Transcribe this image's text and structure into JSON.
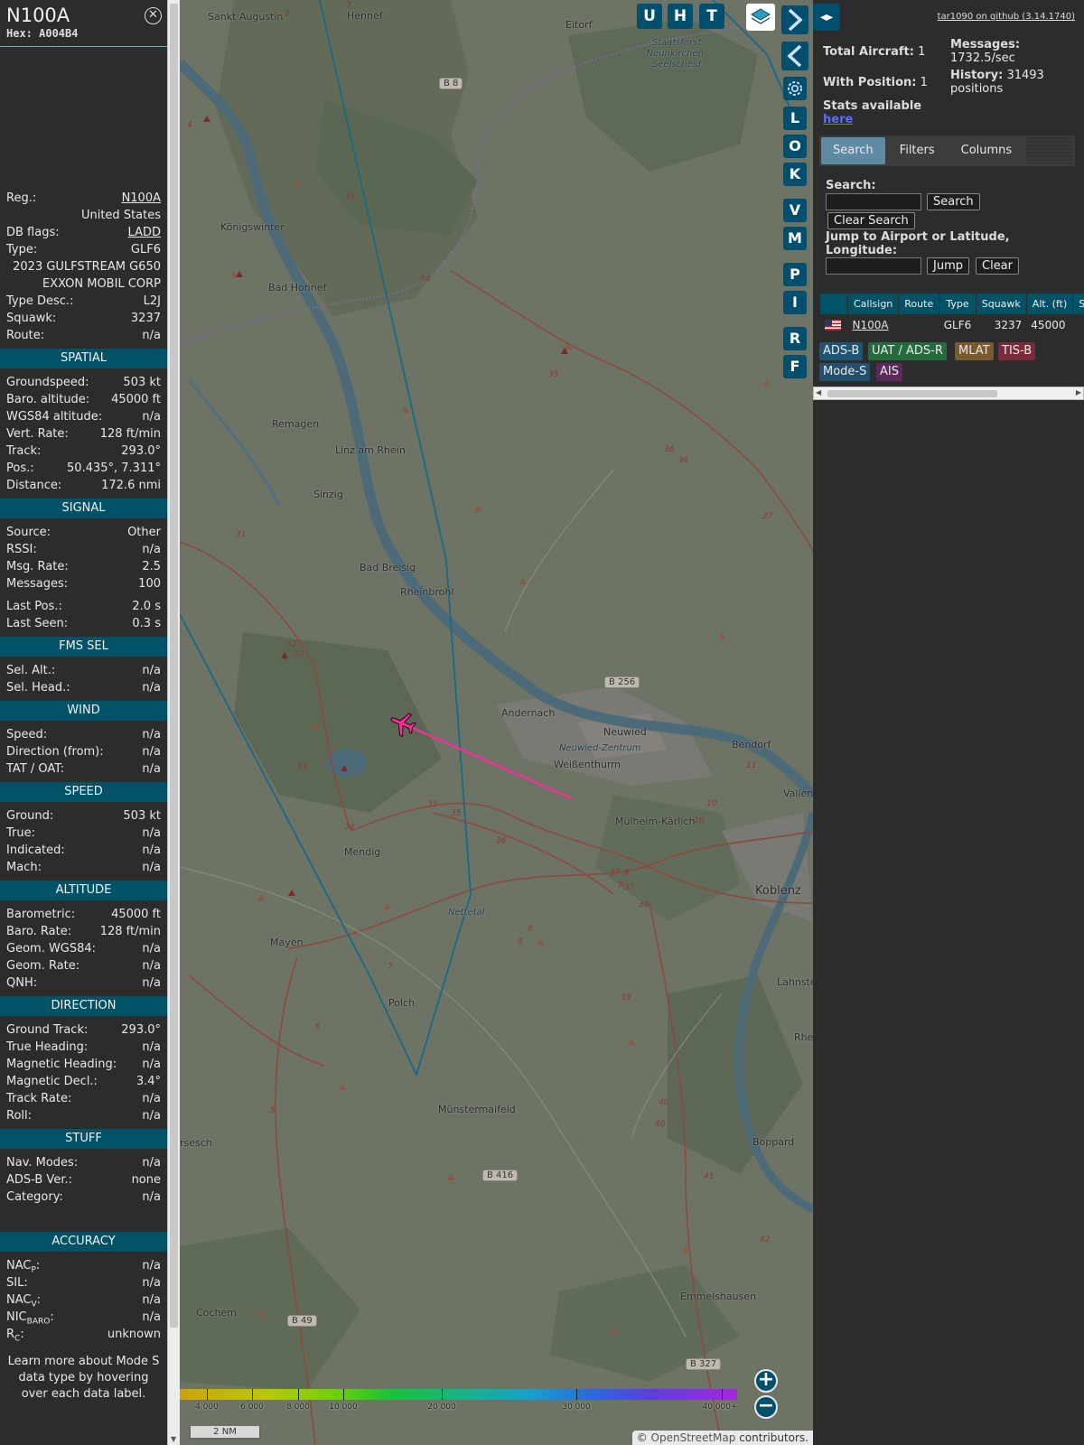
{
  "info": {
    "callsign": "N100A",
    "hex": "Hex: A004B4",
    "close_icon": "close-circle-icon",
    "rows_top": [
      {
        "label": "Reg.:",
        "value": "N100A",
        "link": true
      },
      {
        "label": "",
        "value": "United States"
      },
      {
        "label": "DB flags:",
        "value": "LADD",
        "link": true
      },
      {
        "label": "Type:",
        "value": "GLF6"
      },
      {
        "label": "",
        "value": "2023 GULFSTREAM G650"
      },
      {
        "label": "",
        "value": "EXXON MOBIL CORP"
      },
      {
        "label": "Type Desc.:",
        "value": "L2J"
      },
      {
        "label": "Squawk:",
        "value": "3237"
      },
      {
        "label": "Route:",
        "value": "n/a"
      }
    ],
    "sections": [
      {
        "title": "SPATIAL",
        "rows": [
          {
            "label": "Groundspeed:",
            "value": "503 kt"
          },
          {
            "label": "Baro. altitude:",
            "value": "45000 ft"
          },
          {
            "label": "WGS84 altitude:",
            "value": "n/a"
          },
          {
            "label": "Vert. Rate:",
            "value": "128 ft/min"
          },
          {
            "label": "Track:",
            "value": "293.0°"
          },
          {
            "label": "Pos.:",
            "value": "50.435°, 7.311°"
          },
          {
            "label": "Distance:",
            "value": "172.6 nmi"
          }
        ]
      },
      {
        "title": "SIGNAL",
        "rows": [
          {
            "label": "Source:",
            "value": "Other"
          },
          {
            "label": "RSSI:",
            "value": "n/a"
          },
          {
            "label": "Msg. Rate:",
            "value": "2.5"
          },
          {
            "label": "Messages:",
            "value": "100"
          },
          {
            "gap": true
          },
          {
            "label": "Last Pos.:",
            "value": "2.0 s"
          },
          {
            "label": "Last Seen:",
            "value": "0.3 s"
          }
        ]
      },
      {
        "title": "FMS SEL",
        "rows": [
          {
            "label": "Sel. Alt.:",
            "value": "n/a"
          },
          {
            "label": "Sel. Head.:",
            "value": "n/a"
          }
        ]
      },
      {
        "title": "WIND",
        "rows": [
          {
            "label": "Speed:",
            "value": "n/a"
          },
          {
            "label": "Direction (from):",
            "value": "n/a"
          },
          {
            "label": "TAT / OAT:",
            "value": "n/a"
          }
        ]
      },
      {
        "title": "SPEED",
        "rows": [
          {
            "label": "Ground:",
            "value": "503 kt"
          },
          {
            "label": "True:",
            "value": "n/a"
          },
          {
            "label": "Indicated:",
            "value": "n/a"
          },
          {
            "label": "Mach:",
            "value": "n/a"
          }
        ]
      },
      {
        "title": "ALTITUDE",
        "rows": [
          {
            "label": "Barometric:",
            "value": "45000 ft"
          },
          {
            "label": "Baro. Rate:",
            "value": "128 ft/min"
          },
          {
            "label": "Geom. WGS84:",
            "value": "n/a"
          },
          {
            "label": "Geom. Rate:",
            "value": "n/a"
          },
          {
            "label": "QNH:",
            "value": "n/a"
          }
        ]
      },
      {
        "title": "DIRECTION",
        "rows": [
          {
            "label": "Ground Track:",
            "value": "293.0°"
          },
          {
            "label": "True Heading:",
            "value": "n/a"
          },
          {
            "label": "Magnetic Heading:",
            "value": "n/a"
          },
          {
            "label": "Magnetic Decl.:",
            "value": "3.4°"
          },
          {
            "label": "Track Rate:",
            "value": "n/a"
          },
          {
            "label": "Roll:",
            "value": "n/a"
          }
        ]
      },
      {
        "title": "STUFF",
        "rows": [
          {
            "label": "Nav. Modes:",
            "value": "n/a"
          },
          {
            "label": "ADS-B Ver.:",
            "value": "none"
          },
          {
            "label": "Category:",
            "value": "n/a"
          },
          {
            "bigGap": true
          }
        ]
      },
      {
        "title": "ACCURACY",
        "rows": [
          {
            "label": "NAC",
            "sub": "P",
            "tail": ":",
            "value": "n/a"
          },
          {
            "label": "SIL:",
            "value": "n/a"
          },
          {
            "label": "NAC",
            "sub": "V",
            "tail": ":",
            "value": "n/a"
          },
          {
            "label": "NIC",
            "sub": "BARO",
            "tail": ":",
            "value": "n/a"
          },
          {
            "label": "R",
            "sub": "C",
            "tail": ":",
            "value": "unknown"
          }
        ]
      }
    ],
    "note": "Learn more about Mode S data type by hovering over each data label."
  },
  "map": {
    "buttons_top": [
      "U",
      "H",
      "T"
    ],
    "buttons_side": [
      "L",
      "O",
      "K",
      "V",
      "M",
      "P",
      "I",
      "R",
      "F"
    ],
    "icons": {
      "next": "chevron-right-icon",
      "prev": "chevron-left-icon",
      "settings": "gear-icon",
      "layers": "layers-icon",
      "split": "split-arrows-icon",
      "zoom_in": "plus-icon",
      "zoom_out": "minus-icon",
      "aircraft": "airplane-icon"
    },
    "places": [
      {
        "t": "Sankt Augustin"
      },
      {
        "t": "Hennef"
      },
      {
        "t": "Eitorf"
      },
      {
        "t": "Königswinter"
      },
      {
        "t": "Bad Honnef"
      },
      {
        "t": "Remagen"
      },
      {
        "t": "Linz am Rhein"
      },
      {
        "t": "Sinzig"
      },
      {
        "t": "Bad Breisig"
      },
      {
        "t": "Rheinbrohl"
      },
      {
        "t": "Andernach"
      },
      {
        "t": "Neuwied"
      },
      {
        "t": "Neuwied-Zentrum"
      },
      {
        "t": "Weißenthurm"
      },
      {
        "t": "Bendorf"
      },
      {
        "t": "Vallen"
      },
      {
        "t": "Mülheim-Kärlich"
      },
      {
        "t": "Mendig"
      },
      {
        "t": "Koblenz"
      },
      {
        "t": "Nettetal"
      },
      {
        "t": "Mayen"
      },
      {
        "t": "Lahnstei"
      },
      {
        "t": "Polch"
      },
      {
        "t": "Rhe"
      },
      {
        "t": "Münstermaifeld"
      },
      {
        "t": "rsesch"
      },
      {
        "t": "Boppard"
      },
      {
        "t": "Cochem"
      },
      {
        "t": "Emmelshausen"
      },
      {
        "t": "Staatsforst Neunkirchen-Seelscheid"
      }
    ],
    "roads": [
      "B 8",
      "B 256",
      "B 416",
      "B 49",
      "B 327"
    ],
    "route_numbers": [
      "33",
      "34",
      "35",
      "36",
      "37",
      "38",
      "39",
      "40",
      "41",
      "42",
      "31",
      "32",
      "11",
      "10",
      "9",
      "8",
      "7",
      "6",
      "5",
      "4",
      "3"
    ],
    "altitude_legend": [
      "4 000",
      "6 000",
      "8 000",
      "10 000",
      "20 000",
      "30 000",
      "40 000+"
    ],
    "scale": "2 NM",
    "attribution_prefix": "© ",
    "attribution_link": "OpenStreetMap",
    "attribution_suffix": " contributors."
  },
  "right": {
    "github": "tar1090 on github (3.14.1740)",
    "total_aircraft_label": "Total Aircraft:",
    "total_aircraft": "1",
    "with_position_label": "With Position:",
    "with_position": "1",
    "stats_label": "Stats available",
    "stats_link": "here",
    "messages_label": "Messages:",
    "messages": "1732.5/sec",
    "history_label": "History:",
    "history": "31493",
    "history_unit": "positions",
    "tabs": [
      "Search",
      "Filters",
      "Columns"
    ],
    "search_label": "Search:",
    "search_value": "",
    "search_button": "Search",
    "clear_search_button": "Clear Search",
    "jump_label": "Jump to Airport or Latitude, Longitude:",
    "jump_value": "",
    "jump_button": "Jump",
    "clear_button": "Clear",
    "columns": [
      "",
      "Callsign",
      "Route",
      "Type",
      "Squawk",
      "Alt. (ft)",
      "Spd."
    ],
    "rows": [
      [
        "",
        "N100A",
        "",
        "GLF6",
        "3237",
        "45000",
        ""
      ]
    ],
    "sources": [
      {
        "label": "ADS-B",
        "bg": "#1f5473"
      },
      {
        "label": "UAT / ADS-R",
        "bg": "#256b3e"
      },
      {
        "label": "MLAT",
        "bg": "#7a5a2e"
      },
      {
        "label": "TIS-B",
        "bg": "#7a2b3b"
      },
      {
        "label": "Mode-S",
        "bg": "#23506e"
      },
      {
        "label": "AIS",
        "bg": "#5a2a5a"
      }
    ]
  }
}
